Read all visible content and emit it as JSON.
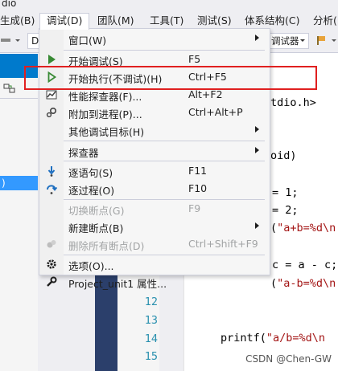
{
  "window": {
    "title_fragment": "dio"
  },
  "menubar": {
    "items": [
      {
        "label": "生成(B)"
      },
      {
        "label": "调试(D)"
      },
      {
        "label": "团队(M)"
      },
      {
        "label": "工具(T)"
      },
      {
        "label": "测试(S)"
      },
      {
        "label": "体系结构(C)"
      },
      {
        "label": "分析("
      }
    ]
  },
  "toolbar": {
    "config_combo": "D",
    "debugger_combo": "调试器"
  },
  "solution": {
    "selected_fragment": ")"
  },
  "editor": {
    "line_numbers": [
      "12",
      "13",
      "14",
      "15"
    ],
    "code_lines": [
      {
        "pre": "",
        "text": "tdio.h>",
        "str": ""
      },
      {
        "pre": "",
        "text": "oid)",
        "str": ""
      },
      {
        "pre": "",
        "text": "= 1;",
        "str": ""
      },
      {
        "pre": "",
        "text": "= 2;",
        "str": ""
      },
      {
        "pre": "(",
        "text": "",
        "str": "\"a+b=%d\\n"
      },
      {
        "pre": "",
        "text": "c = a - c;",
        "str": ""
      },
      {
        "pre": "(",
        "text": "",
        "str": "\"a-b=%d\\n"
      },
      {
        "pre": "printf(",
        "text": "",
        "str": "\"a/b=%d\\n"
      }
    ]
  },
  "debug_menu": {
    "items": [
      {
        "icon": "none",
        "label": "窗口(W)",
        "shortcut": "",
        "submenu": true,
        "enabled": true
      },
      {
        "icon": "play-icon",
        "label": "开始调试(S)",
        "shortcut": "F5",
        "submenu": false,
        "enabled": true
      },
      {
        "icon": "play-outline-icon",
        "label": "开始执行(不调试)(H)",
        "shortcut": "Ctrl+F5",
        "submenu": false,
        "enabled": true
      },
      {
        "icon": "profiler-icon",
        "label": "性能探查器(F)...",
        "shortcut": "Alt+F2",
        "submenu": false,
        "enabled": true
      },
      {
        "icon": "attach-process-icon",
        "label": "附加到进程(P)...",
        "shortcut": "Ctrl+Alt+P",
        "submenu": false,
        "enabled": true
      },
      {
        "icon": "none",
        "label": "其他调试目标(H)",
        "shortcut": "",
        "submenu": true,
        "enabled": true
      },
      {
        "icon": "none",
        "label": "探查器",
        "shortcut": "",
        "submenu": true,
        "enabled": true
      },
      {
        "icon": "step-into-icon",
        "label": "逐语句(S)",
        "shortcut": "F11",
        "submenu": false,
        "enabled": true
      },
      {
        "icon": "step-over-icon",
        "label": "逐过程(O)",
        "shortcut": "F10",
        "submenu": false,
        "enabled": true
      },
      {
        "icon": "none",
        "label": "切换断点(G)",
        "shortcut": "F9",
        "submenu": false,
        "enabled": false
      },
      {
        "icon": "none",
        "label": "新建断点(B)",
        "shortcut": "",
        "submenu": true,
        "enabled": true
      },
      {
        "icon": "delete-breakpoints-icon",
        "label": "删除所有断点(D)",
        "shortcut": "Ctrl+Shift+F9",
        "submenu": false,
        "enabled": false
      },
      {
        "icon": "gear-icon",
        "label": "选项(O)...",
        "shortcut": "",
        "submenu": false,
        "enabled": true
      },
      {
        "icon": "wrench-icon",
        "label": "Project_unit1 属性...",
        "shortcut": "",
        "submenu": false,
        "enabled": true
      }
    ]
  },
  "watermark": "CSDN @Chen-GW",
  "colors": {
    "accent": "#007acc",
    "highlight_box": "#e02020",
    "play_green": "#388a34",
    "string_red": "#a31515",
    "line_number": "#2b91af"
  }
}
